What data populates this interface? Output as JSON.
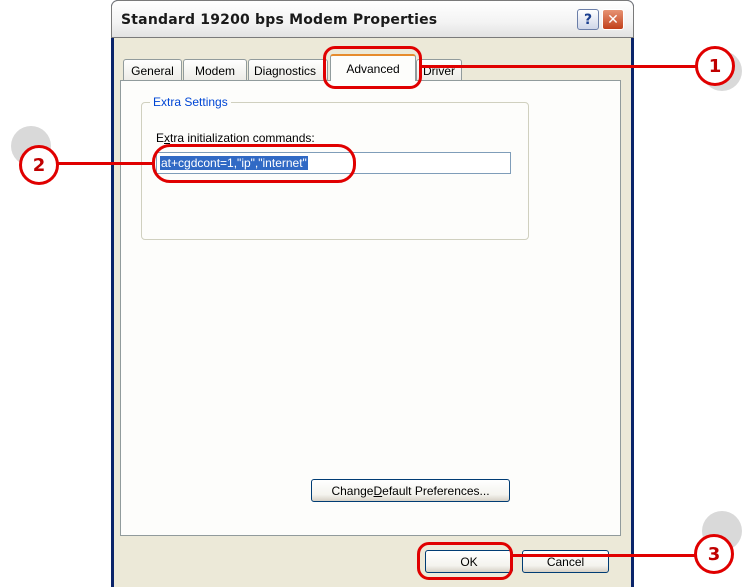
{
  "window": {
    "title": "Standard 19200 bps Modem Properties",
    "help_glyph": "?",
    "close_glyph": "✕"
  },
  "tabs": [
    {
      "label": "General"
    },
    {
      "label": "Modem"
    },
    {
      "label": "Diagnostics"
    },
    {
      "label": "Advanced",
      "active": true
    },
    {
      "label": "Driver"
    }
  ],
  "extra_settings": {
    "group_label": "Extra Settings",
    "field_label_underlined": "x",
    "field_label_prefix": "E",
    "field_label_rest": "tra initialization commands:",
    "value": "at+cgdcont=1,\"ip\",\"internet\""
  },
  "buttons": {
    "change_prefix": "Change ",
    "change_underlined": "D",
    "change_rest": "efault Preferences...",
    "ok": "OK",
    "cancel": "Cancel"
  },
  "annotations": [
    "1",
    "2",
    "3"
  ],
  "colors": {
    "annotation": "#e00000",
    "accent_tab": "#e68b2c",
    "group_label": "#0046d5",
    "selection": "#316ac5"
  }
}
